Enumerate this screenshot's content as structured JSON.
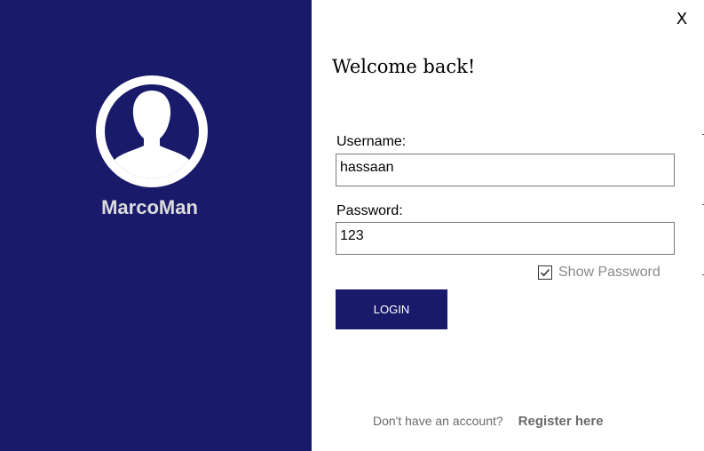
{
  "window": {
    "close_label": "X"
  },
  "sidebar": {
    "app_name": "MarcoMan",
    "avatar_icon": "user-silhouette-icon",
    "background": "#1a1a6b"
  },
  "form": {
    "title": "Welcome back!",
    "username_label": "Username:",
    "username_value": "hassaan",
    "password_label": "Password:",
    "password_value": "123",
    "show_password_label": "Show Password",
    "show_password_checked": true,
    "login_label": "LOGIN",
    "register_prompt": "Don't have an account?",
    "register_link": "Register here"
  },
  "colors": {
    "accent": "#1a1a6b",
    "muted_text": "#8a8a8a"
  }
}
